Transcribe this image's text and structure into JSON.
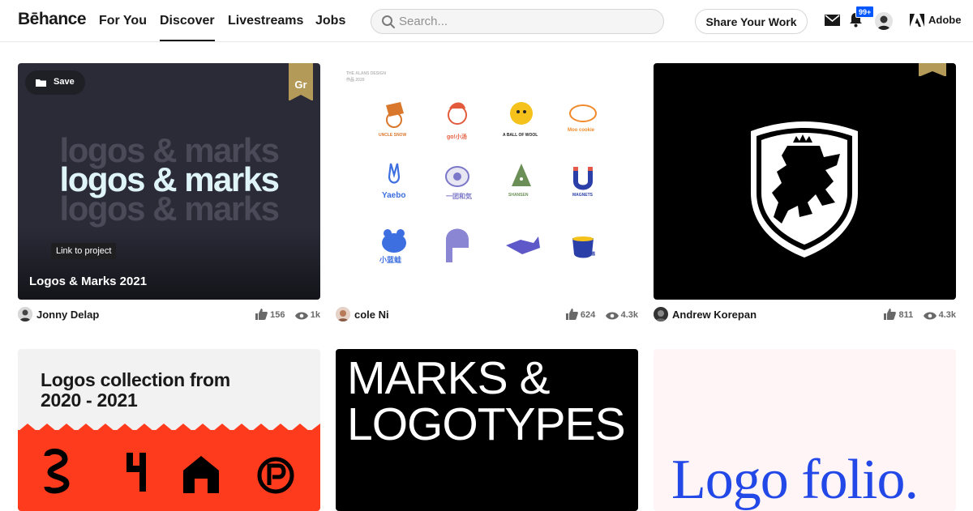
{
  "nav": {
    "logo": "Bēhance",
    "links": [
      "For You",
      "Discover",
      "Livestreams",
      "Jobs"
    ],
    "active_link": "Discover",
    "search_placeholder": "Search...",
    "share_label": "Share Your Work",
    "notifications_badge": "99+",
    "adobe_label": "Adobe"
  },
  "colors": {
    "accent": "#0057ff",
    "ribbon_gold": "#b49a59",
    "card1_bg": "#2b2b38",
    "orange_band": "#ff3b1d",
    "logofolio_blue": "#2348e8",
    "cole_ni_illustrations": "#ff7a1a"
  },
  "projects": [
    {
      "title": "Logos & Marks 2021",
      "artwork_text": [
        "logos & marks",
        "logos & marks",
        "logos & marks"
      ],
      "save_label": "Save",
      "ribbon_label": "Gr",
      "tooltip": "Link to project",
      "owner": "Jonny Delap",
      "appreciations": "156",
      "views": "1k"
    },
    {
      "title": "",
      "owner": "cole Ni",
      "appreciations": "624",
      "views": "4.3k",
      "artwork_header": [
        "THE ALANS DESIGN",
        "作品 2020"
      ],
      "artwork_labels": [
        "UNCLE SNOW",
        "go!小汤",
        "A BALL OF WOOL",
        "Moo cookie",
        "Yaebo",
        "一团和気",
        "SHANSEN",
        "MAGNETS",
        "小蓝蛙",
        "",
        "",
        "猫"
      ]
    },
    {
      "title": "",
      "owner": "Andrew Korepan",
      "appreciations": "811",
      "views": "4.3k"
    },
    {
      "title": "",
      "artwork_text": "Logos collection from 2020 - 2021"
    },
    {
      "title": "",
      "artwork_text": "MARKS & LOGOTYPES"
    },
    {
      "title": "",
      "artwork_text": "Logo folio."
    }
  ]
}
